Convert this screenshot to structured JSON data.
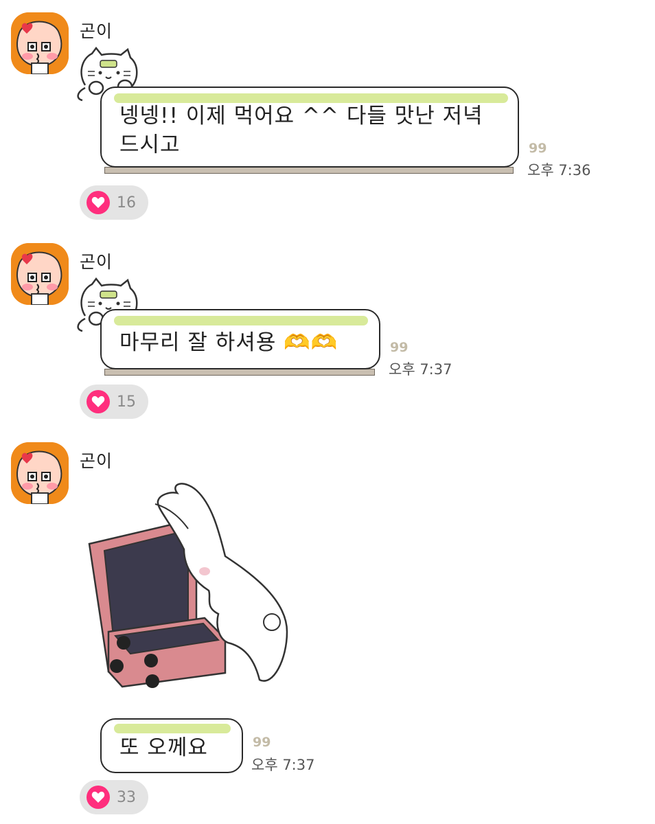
{
  "messages": [
    {
      "sender": "곤이",
      "text_line1": "넹넹!! 이제 먹어요 ^^ 다들 맛난 저녁",
      "text_line2": "드시고",
      "read_count": "99",
      "time": "오후 7:36",
      "likes": "16"
    },
    {
      "sender": "곤이",
      "text_line1": "마무리 잘 하셔용 🫶🫶",
      "read_count": "99",
      "time": "오후 7:37",
      "likes": "15"
    },
    {
      "sender": "곤이",
      "text_line1": "또 오께요",
      "read_count": "99",
      "time": "오후 7:37",
      "likes": "33"
    }
  ],
  "icons": {
    "avatar": "apeach-avatar-icon",
    "like": "heart-icon",
    "decoration": "cat-peeking-icon",
    "sticker": "bunny-with-suitcase-sticker"
  },
  "colors": {
    "avatar_bg": "#f08a1a",
    "heart": "#ff2e7d",
    "highlight": "#d8ea9a",
    "read_count": "#c3bba7"
  }
}
